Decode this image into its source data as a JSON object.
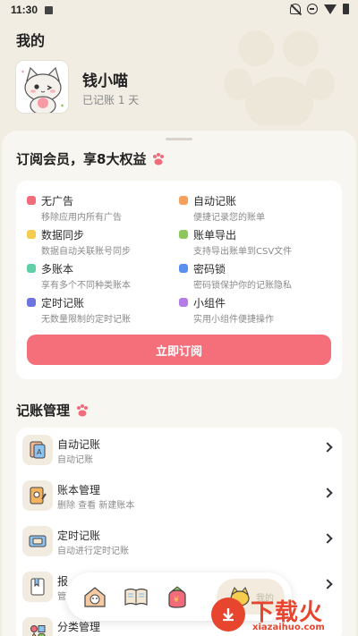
{
  "status_bar": {
    "time": "11:30"
  },
  "header": {
    "title": "我的"
  },
  "user": {
    "name": "钱小喵",
    "days": "已记账 1 天"
  },
  "membership": {
    "title": "订阅会员，享8大权益",
    "benefits": [
      {
        "title": "无广告",
        "desc": "移除应用内所有广告",
        "color": "#F26B7A"
      },
      {
        "title": "自动记账",
        "desc": "便捷记录您的账单",
        "color": "#F6A05C"
      },
      {
        "title": "数据同步",
        "desc": "数据自动关联账号同步",
        "color": "#F5CC4E"
      },
      {
        "title": "账单导出",
        "desc": "支持导出账单到CSV文件",
        "color": "#8CC85A"
      },
      {
        "title": "多账本",
        "desc": "享有多个不同种类账本",
        "color": "#5FCFA8"
      },
      {
        "title": "密码锁",
        "desc": "密码锁保护你的记账隐私",
        "color": "#5B8FEF"
      },
      {
        "title": "定时记账",
        "desc": "无数量限制的定时记账",
        "color": "#6D73E0"
      },
      {
        "title": "小组件",
        "desc": "实用小组件便捷操作",
        "color": "#B67BE8"
      }
    ],
    "subscribe_label": "立即订阅"
  },
  "management": {
    "title": "记账管理",
    "items": [
      {
        "title": "自动记账",
        "desc": "自动记账",
        "icon": "auto-record-icon"
      },
      {
        "title": "账本管理",
        "desc": "删除 查看 新建账本",
        "icon": "ledger-icon"
      },
      {
        "title": "定时记账",
        "desc": "自动进行定时记账",
        "icon": "timer-ticket-icon"
      },
      {
        "title": "报",
        "desc": "管",
        "icon": "report-icon"
      },
      {
        "title": "分类管理",
        "desc": "",
        "icon": "category-icon"
      }
    ]
  },
  "bottom_nav": {
    "items": [
      "home-icon",
      "book-icon",
      "wallet-bag-icon",
      "mine-icon"
    ],
    "active_label": "我的"
  },
  "watermark": {
    "text": "下载火",
    "sub": "xiazaihuo.com",
    "color": "#E8452E"
  }
}
